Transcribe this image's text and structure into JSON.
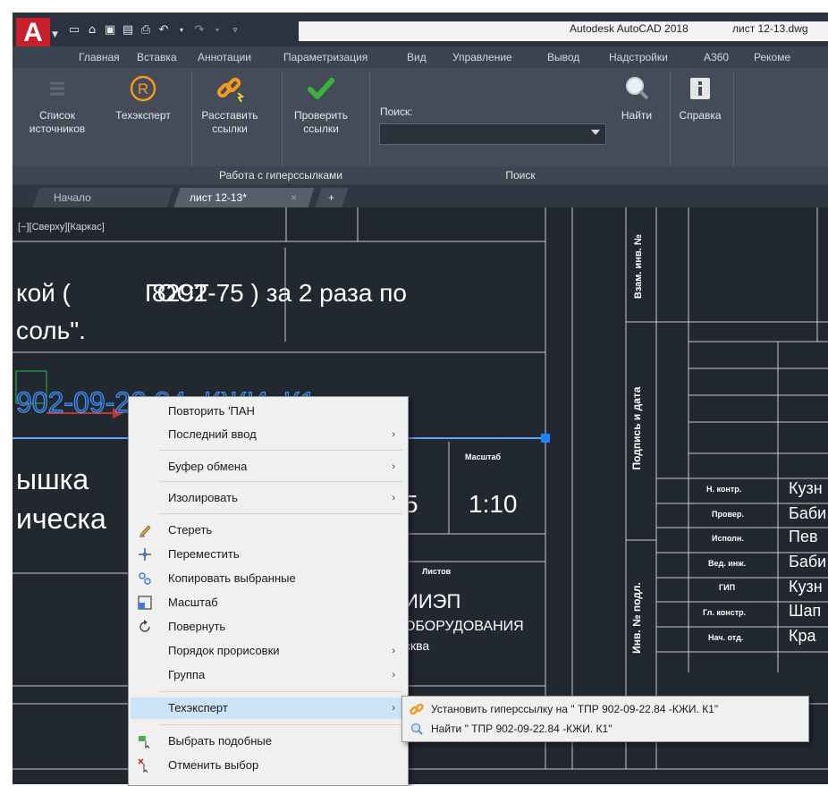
{
  "window": {
    "app_title": "Autodesk AutoCAD 2018",
    "file_title": "лист 12-13.dwg",
    "logo": "A"
  },
  "ribbon_tabs": [
    "Главная",
    "Вставка",
    "Аннотации",
    "Параметризация",
    "Вид",
    "Управление",
    "Вывод",
    "Надстройки",
    "A360",
    "Рекоме"
  ],
  "ribbon": {
    "buttons": {
      "sources": "Список\nисточников",
      "techexpert": "Техэксперт",
      "place_links": "Расставить\nссылки",
      "check_links": "Проверить\nссылки",
      "find": "Найти",
      "help": "Справка"
    },
    "search_label": "Поиск:",
    "search_value": "",
    "groups": {
      "hyperlinks": "Работа с гиперссылками",
      "search": "Поиск"
    }
  },
  "file_tabs": {
    "start": "Начало",
    "active": "лист 12-13*",
    "close": "×",
    "plus": "+"
  },
  "viewport": {
    "label": "[−][Сверху][Каркас]"
  },
  "drawing": {
    "line1a": "кой (",
    "line1b": "ГОСТ",
    "line1c": "8292-75 ) за 2 раза по",
    "line2": "соль\".",
    "highlight_text": "902-09-22.84 -КЖИ. К1",
    "part_a": "ышка",
    "part_b": "ическа",
    "num5": "5",
    "scale_label": "Масштаб",
    "scale_value": "1:10",
    "sheets_label": "Листов",
    "org_a": "ИИЭП",
    "org_b": "ОБОРУДОВАНИЯ",
    "org_c": "сква",
    "vert1": "Взам. инв. №",
    "vert2": "Подпись и дата",
    "vert3": "Инв. № подл.",
    "roles": [
      "Н. контр.",
      "Провер.",
      "Исполн.",
      "Вед. инж.",
      "ГИП",
      "Гл. констр.",
      "Нач. отд."
    ],
    "names": [
      "Кузн",
      "Баби",
      "Пев",
      "Баби",
      "Кузн",
      "Шап",
      "Кра"
    ]
  },
  "context_menu": {
    "items": [
      {
        "label": "Повторить 'ПАН",
        "submenu": false
      },
      {
        "label": "Последний ввод",
        "submenu": true
      },
      {
        "label": "Буфер обмена",
        "submenu": true
      },
      {
        "label": "Изолировать",
        "submenu": true
      },
      {
        "label": "Стереть",
        "icon": "eraser-icon"
      },
      {
        "label": "Переместить",
        "icon": "move-icon"
      },
      {
        "label": "Копировать выбранные",
        "icon": "copy-icon"
      },
      {
        "label": "Масштаб",
        "icon": "scale-icon"
      },
      {
        "label": "Повернуть",
        "icon": "rotate-icon"
      },
      {
        "label": "Порядок прорисовки",
        "submenu": true
      },
      {
        "label": "Группа",
        "submenu": true
      },
      {
        "label": "Техэксперт",
        "submenu": true,
        "highlighted": true
      },
      {
        "label": "Выбрать подобные",
        "icon": "select-similar-icon"
      },
      {
        "label": "Отменить выбор",
        "icon": "deselect-icon"
      }
    ]
  },
  "submenu": {
    "items": [
      {
        "label": "Установить гиперссылку на \" ТПР 902-09-22.84  -КЖИ. К1\"",
        "icon": "link-icon"
      },
      {
        "label": "Найти \" ТПР 902-09-22.84  -КЖИ. К1\"",
        "icon": "search-icon"
      }
    ]
  },
  "colors": {
    "highlight_text": "#4aa3ff",
    "menu_highlight": "#cce4f7",
    "accent_red": "#c7202a",
    "techexpert_orange": "#f39a1e",
    "check_green": "#3cb23c"
  }
}
